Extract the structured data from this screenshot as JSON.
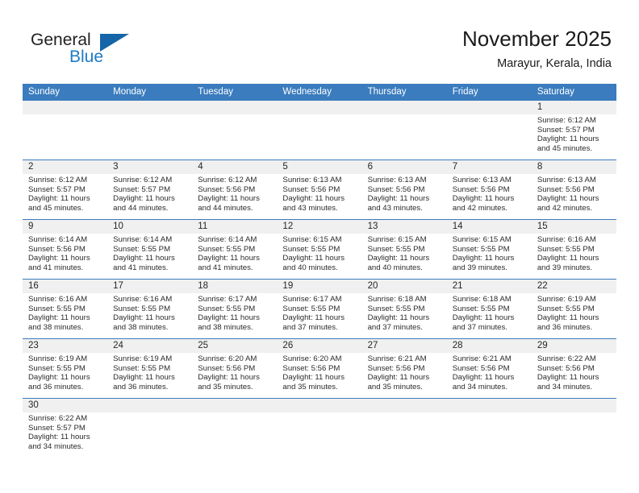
{
  "brand": {
    "name_top": "General",
    "name_bottom": "Blue",
    "color_dark": "#231f20",
    "color_blue": "#1e7ac4",
    "triangle_color": "#1565a8"
  },
  "header": {
    "title": "November 2025",
    "subtitle": "Marayur, Kerala, India"
  },
  "theme": {
    "header_row_bg": "#3a7cbe",
    "date_band_bg": "#f0f0f0",
    "divider": "#3a7cbe",
    "text": "#2b2b2b"
  },
  "calendar": {
    "day_names": [
      "Sunday",
      "Monday",
      "Tuesday",
      "Wednesday",
      "Thursday",
      "Friday",
      "Saturday"
    ],
    "weeks": [
      {
        "days": [
          {
            "date": "",
            "lines": []
          },
          {
            "date": "",
            "lines": []
          },
          {
            "date": "",
            "lines": []
          },
          {
            "date": "",
            "lines": []
          },
          {
            "date": "",
            "lines": []
          },
          {
            "date": "",
            "lines": []
          },
          {
            "date": "1",
            "lines": [
              "Sunrise: 6:12 AM",
              "Sunset: 5:57 PM",
              "Daylight: 11 hours",
              "and 45 minutes."
            ]
          }
        ]
      },
      {
        "days": [
          {
            "date": "2",
            "lines": [
              "Sunrise: 6:12 AM",
              "Sunset: 5:57 PM",
              "Daylight: 11 hours",
              "and 45 minutes."
            ]
          },
          {
            "date": "3",
            "lines": [
              "Sunrise: 6:12 AM",
              "Sunset: 5:57 PM",
              "Daylight: 11 hours",
              "and 44 minutes."
            ]
          },
          {
            "date": "4",
            "lines": [
              "Sunrise: 6:12 AM",
              "Sunset: 5:56 PM",
              "Daylight: 11 hours",
              "and 44 minutes."
            ]
          },
          {
            "date": "5",
            "lines": [
              "Sunrise: 6:13 AM",
              "Sunset: 5:56 PM",
              "Daylight: 11 hours",
              "and 43 minutes."
            ]
          },
          {
            "date": "6",
            "lines": [
              "Sunrise: 6:13 AM",
              "Sunset: 5:56 PM",
              "Daylight: 11 hours",
              "and 43 minutes."
            ]
          },
          {
            "date": "7",
            "lines": [
              "Sunrise: 6:13 AM",
              "Sunset: 5:56 PM",
              "Daylight: 11 hours",
              "and 42 minutes."
            ]
          },
          {
            "date": "8",
            "lines": [
              "Sunrise: 6:13 AM",
              "Sunset: 5:56 PM",
              "Daylight: 11 hours",
              "and 42 minutes."
            ]
          }
        ]
      },
      {
        "days": [
          {
            "date": "9",
            "lines": [
              "Sunrise: 6:14 AM",
              "Sunset: 5:56 PM",
              "Daylight: 11 hours",
              "and 41 minutes."
            ]
          },
          {
            "date": "10",
            "lines": [
              "Sunrise: 6:14 AM",
              "Sunset: 5:55 PM",
              "Daylight: 11 hours",
              "and 41 minutes."
            ]
          },
          {
            "date": "11",
            "lines": [
              "Sunrise: 6:14 AM",
              "Sunset: 5:55 PM",
              "Daylight: 11 hours",
              "and 41 minutes."
            ]
          },
          {
            "date": "12",
            "lines": [
              "Sunrise: 6:15 AM",
              "Sunset: 5:55 PM",
              "Daylight: 11 hours",
              "and 40 minutes."
            ]
          },
          {
            "date": "13",
            "lines": [
              "Sunrise: 6:15 AM",
              "Sunset: 5:55 PM",
              "Daylight: 11 hours",
              "and 40 minutes."
            ]
          },
          {
            "date": "14",
            "lines": [
              "Sunrise: 6:15 AM",
              "Sunset: 5:55 PM",
              "Daylight: 11 hours",
              "and 39 minutes."
            ]
          },
          {
            "date": "15",
            "lines": [
              "Sunrise: 6:16 AM",
              "Sunset: 5:55 PM",
              "Daylight: 11 hours",
              "and 39 minutes."
            ]
          }
        ]
      },
      {
        "days": [
          {
            "date": "16",
            "lines": [
              "Sunrise: 6:16 AM",
              "Sunset: 5:55 PM",
              "Daylight: 11 hours",
              "and 38 minutes."
            ]
          },
          {
            "date": "17",
            "lines": [
              "Sunrise: 6:16 AM",
              "Sunset: 5:55 PM",
              "Daylight: 11 hours",
              "and 38 minutes."
            ]
          },
          {
            "date": "18",
            "lines": [
              "Sunrise: 6:17 AM",
              "Sunset: 5:55 PM",
              "Daylight: 11 hours",
              "and 38 minutes."
            ]
          },
          {
            "date": "19",
            "lines": [
              "Sunrise: 6:17 AM",
              "Sunset: 5:55 PM",
              "Daylight: 11 hours",
              "and 37 minutes."
            ]
          },
          {
            "date": "20",
            "lines": [
              "Sunrise: 6:18 AM",
              "Sunset: 5:55 PM",
              "Daylight: 11 hours",
              "and 37 minutes."
            ]
          },
          {
            "date": "21",
            "lines": [
              "Sunrise: 6:18 AM",
              "Sunset: 5:55 PM",
              "Daylight: 11 hours",
              "and 37 minutes."
            ]
          },
          {
            "date": "22",
            "lines": [
              "Sunrise: 6:19 AM",
              "Sunset: 5:55 PM",
              "Daylight: 11 hours",
              "and 36 minutes."
            ]
          }
        ]
      },
      {
        "days": [
          {
            "date": "23",
            "lines": [
              "Sunrise: 6:19 AM",
              "Sunset: 5:55 PM",
              "Daylight: 11 hours",
              "and 36 minutes."
            ]
          },
          {
            "date": "24",
            "lines": [
              "Sunrise: 6:19 AM",
              "Sunset: 5:55 PM",
              "Daylight: 11 hours",
              "and 36 minutes."
            ]
          },
          {
            "date": "25",
            "lines": [
              "Sunrise: 6:20 AM",
              "Sunset: 5:56 PM",
              "Daylight: 11 hours",
              "and 35 minutes."
            ]
          },
          {
            "date": "26",
            "lines": [
              "Sunrise: 6:20 AM",
              "Sunset: 5:56 PM",
              "Daylight: 11 hours",
              "and 35 minutes."
            ]
          },
          {
            "date": "27",
            "lines": [
              "Sunrise: 6:21 AM",
              "Sunset: 5:56 PM",
              "Daylight: 11 hours",
              "and 35 minutes."
            ]
          },
          {
            "date": "28",
            "lines": [
              "Sunrise: 6:21 AM",
              "Sunset: 5:56 PM",
              "Daylight: 11 hours",
              "and 34 minutes."
            ]
          },
          {
            "date": "29",
            "lines": [
              "Sunrise: 6:22 AM",
              "Sunset: 5:56 PM",
              "Daylight: 11 hours",
              "and 34 minutes."
            ]
          }
        ]
      },
      {
        "days": [
          {
            "date": "30",
            "lines": [
              "Sunrise: 6:22 AM",
              "Sunset: 5:57 PM",
              "Daylight: 11 hours",
              "and 34 minutes."
            ]
          },
          {
            "date": "",
            "lines": []
          },
          {
            "date": "",
            "lines": []
          },
          {
            "date": "",
            "lines": []
          },
          {
            "date": "",
            "lines": []
          },
          {
            "date": "",
            "lines": []
          },
          {
            "date": "",
            "lines": []
          }
        ]
      }
    ]
  }
}
